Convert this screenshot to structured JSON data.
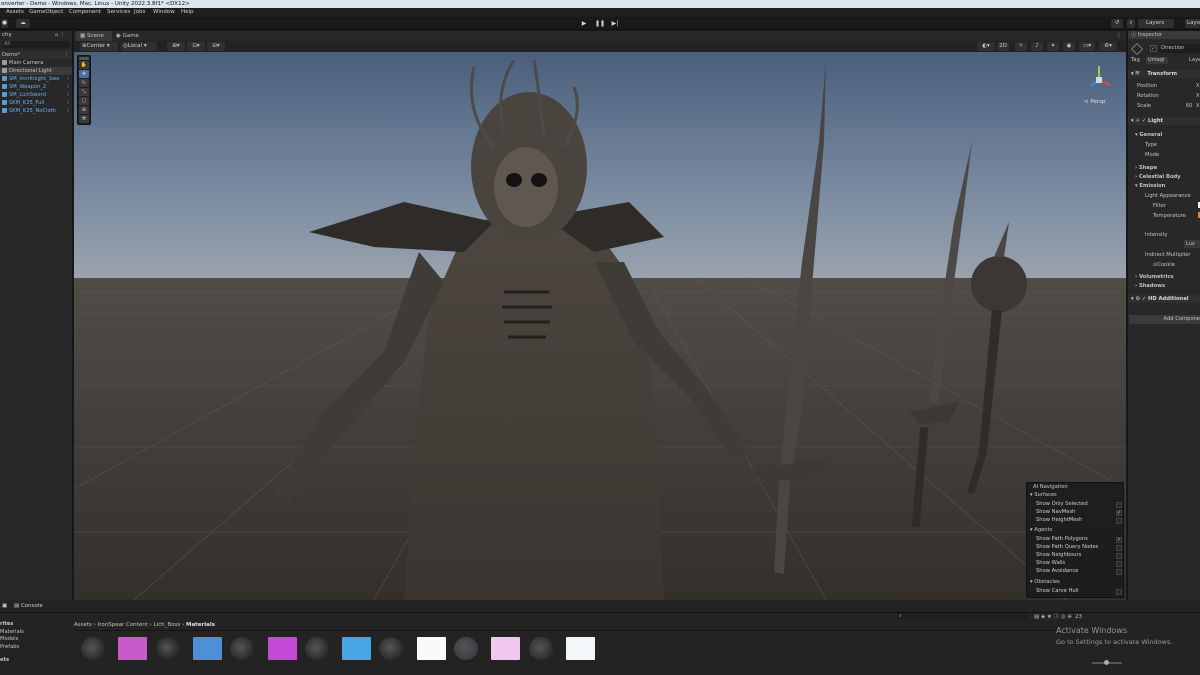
{
  "title_bar": {
    "text": "onverter - Demo - Windows, Mac, Linux - Unity 2022.3.8f1* <DX12>"
  },
  "menu": [
    "Assets",
    "GameObject",
    "Component",
    "Services",
    "Jobs",
    "Window",
    "Help"
  ],
  "toolbar": {
    "layers_label": "Layers",
    "layout_label": "Layo",
    "play_icon": "play-icon",
    "pause_icon": "pause-icon",
    "step_icon": "step-icon"
  },
  "hierarchy": {
    "tab": "chy",
    "search_placeholder": "All",
    "items": [
      {
        "label": "Demo*"
      },
      {
        "label": "Main Camera"
      },
      {
        "label": "Directional Light"
      },
      {
        "label": "SM_IronKnight_Swo"
      },
      {
        "label": "SM_Weapon_2"
      },
      {
        "label": "SM_LichSword"
      },
      {
        "label": "SKM_K35_Full"
      },
      {
        "label": "SKM_K35_NoCloth"
      }
    ]
  },
  "scene": {
    "tab_scene": "Scene",
    "tab_game": "Game",
    "pivot": "Center",
    "space": "Local",
    "mode_2d": "2D",
    "persp_label": "< Persp"
  },
  "ai_navigation": {
    "title": "AI Navigation",
    "sections": [
      {
        "title": "Surfaces",
        "items": [
          {
            "label": "Show Only Selected",
            "checked": false
          },
          {
            "label": "Show NavMesh",
            "checked": true
          },
          {
            "label": "Show HeightMesh",
            "checked": false
          }
        ]
      },
      {
        "title": "Agents",
        "items": [
          {
            "label": "Show Path Polygons",
            "checked": true
          },
          {
            "label": "Show Path Query Nodes",
            "checked": false
          },
          {
            "label": "Show Neighbours",
            "checked": false
          },
          {
            "label": "Show Walls",
            "checked": false
          },
          {
            "label": "Show Avoidance",
            "checked": false
          }
        ]
      },
      {
        "title": "Obstacles",
        "items": [
          {
            "label": "Show Carve Hull",
            "checked": false
          }
        ]
      }
    ]
  },
  "inspector": {
    "tab": "Inspector",
    "object_name": "Direction",
    "tag_label": "Tag",
    "tag_value": "Untagi",
    "layer_label": "Laye",
    "transform": {
      "title": "Transform",
      "position": "Position",
      "rotation": "Rotation",
      "scale": "Scale",
      "scale_value": "60",
      "axis": "X"
    },
    "light": {
      "title": "Light",
      "general": "General",
      "type": "Type",
      "mode": "Mode",
      "shape": "Shape",
      "celestial": "Celestial Body",
      "emission": "Emission",
      "light_appearance": "Light Appearance",
      "filter": "Filter",
      "temperature": "Temperature",
      "intensity": "Intensity",
      "intensity_unit": "Lux",
      "indirect": "Indirect Multiplier",
      "cookie": "Cookie",
      "volumetrics": "Volumetrics",
      "shadows": "Shadows"
    },
    "hd_additional": "HD Additional",
    "add_component": "Add Compone"
  },
  "bottom": {
    "tab_console": "Console",
    "favorites": [
      "rites",
      "Materials",
      "Models",
      "Prefabs"
    ],
    "assets_label": "ets",
    "breadcrumb": [
      "Assets",
      "IronSpear Content",
      "Lich_Boss",
      "Materials"
    ],
    "counter": "23",
    "thumb_colors": [
      "#2b2b2b",
      "#c85bc9",
      "#242424",
      "#4f8fd6",
      "#2a2a2a",
      "#c44ad6",
      "#2b2b2b",
      "#48a6e6",
      "#2c2c2c",
      "#fafafa",
      "#3a3e44",
      "#f0c8ee",
      "#2e2e2e",
      "#f2f8f9"
    ]
  },
  "watermark": {
    "line1": "Activate Windows",
    "line2": "Go to Settings to activate Windows."
  }
}
